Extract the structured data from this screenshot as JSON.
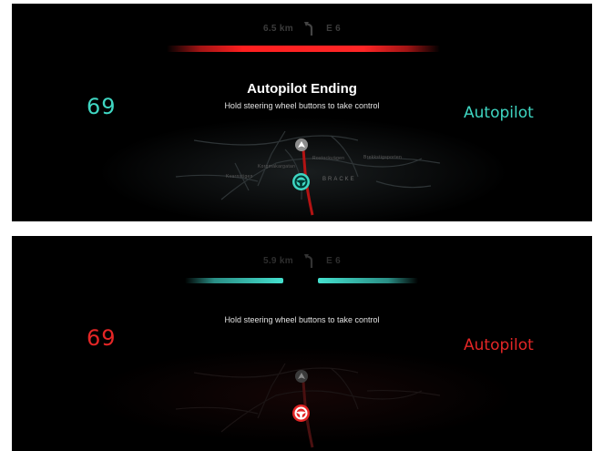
{
  "panel_alert": {
    "navigation": {
      "distance": "6.5 km",
      "road": "E 6",
      "turn_icon": "sharp-left-turn-icon"
    },
    "headline": "Autopilot Ending",
    "instruction": "Hold steering wheel buttons to take control",
    "speed": "69",
    "mode_label": "Autopilot",
    "map_labels": {
      "district": "BRACKE",
      "road_1": "Brekkstigsporten",
      "road_2": "Rostockvägen",
      "road_3": "Kvarnstigen",
      "road_4": "Korgmakargatan"
    },
    "accent_color": "#3fd6c2",
    "alert_color": "#ff2626"
  },
  "panel_warning": {
    "navigation": {
      "distance": "5.9 km",
      "road": "E 6",
      "turn_icon": "sharp-left-turn-icon"
    },
    "instruction": "Hold steering wheel buttons to take control",
    "speed": "69",
    "mode_label": "Autopilot",
    "accent_color": "#e42626",
    "bar_color": "#45e1cf"
  }
}
